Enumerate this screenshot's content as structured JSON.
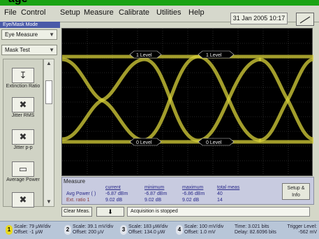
{
  "window": {
    "title_fragment": "age"
  },
  "menu": [
    "File",
    "Control",
    "Setup",
    "Measure",
    "Calibrate",
    "Utilities",
    "Help"
  ],
  "datetime": "31 Jan 2005  10:17",
  "left_panel": {
    "mode_header": "Eye/Mask Mode",
    "mode_select": "Eye Measure",
    "test_select": "Mask Test",
    "tools": [
      {
        "label": "Extinction Ratio",
        "icon": "extinction-ratio-icon"
      },
      {
        "label": "Jitter RMS",
        "icon": "jitter-rms-icon"
      },
      {
        "label": "Jitter p-p",
        "icon": "jitter-pp-icon"
      },
      {
        "label": "Average Power",
        "icon": "average-power-icon"
      },
      {
        "label": "",
        "icon": "crossing-icon"
      }
    ]
  },
  "markers": {
    "level1_left": "1 Level",
    "level1_right": "1 Level",
    "level0_left": "0 Level",
    "level0_right": "0 Level"
  },
  "colors": {
    "trace": "#d8d23a",
    "graticule_bg": "#000000",
    "grid": "#555555"
  },
  "measure": {
    "tab": "Measure",
    "headers": [
      "current",
      "minimum",
      "maximum",
      "total meas"
    ],
    "rows": [
      {
        "name": "Avg Power (  )",
        "current": "-6.87 dBm",
        "minimum": "-6.87 dBm",
        "maximum": "-6.86 dBm",
        "total": "40"
      },
      {
        "name": "Ext. ratio 1",
        "current": "9.02 dB",
        "minimum": "9.02 dB",
        "maximum": "9.02 dB",
        "total": "14"
      }
    ],
    "setup_label": "Setup & Info"
  },
  "controls": {
    "clear": "Clear Meas.",
    "run": "⬇",
    "status": "Acquisition is stopped"
  },
  "channels": [
    {
      "num": "1",
      "scale": "Scale: 79 μW/div",
      "offset": "Offset: -1 μW",
      "color": "#e8d820"
    },
    {
      "num": "2",
      "scale": "Scale: 39.1 mV/div",
      "offset": "Offset: 200 μV",
      "color": "#e0e4ec"
    },
    {
      "num": "3",
      "scale": "Scale: 183 μW/div",
      "offset": "Offset: 134.0 μW",
      "color": "#e0e4ec"
    },
    {
      "num": "4",
      "scale": "Scale: 100 mV/div",
      "offset": "Offset: 1.0 mV",
      "color": "#e0e4ec"
    }
  ],
  "time": {
    "scale": "Time: 3.021 bits",
    "delay": "Delay: 82.6096 bits"
  },
  "trigger": {
    "label": "Trigger Level:",
    "value": "-562 mV"
  }
}
